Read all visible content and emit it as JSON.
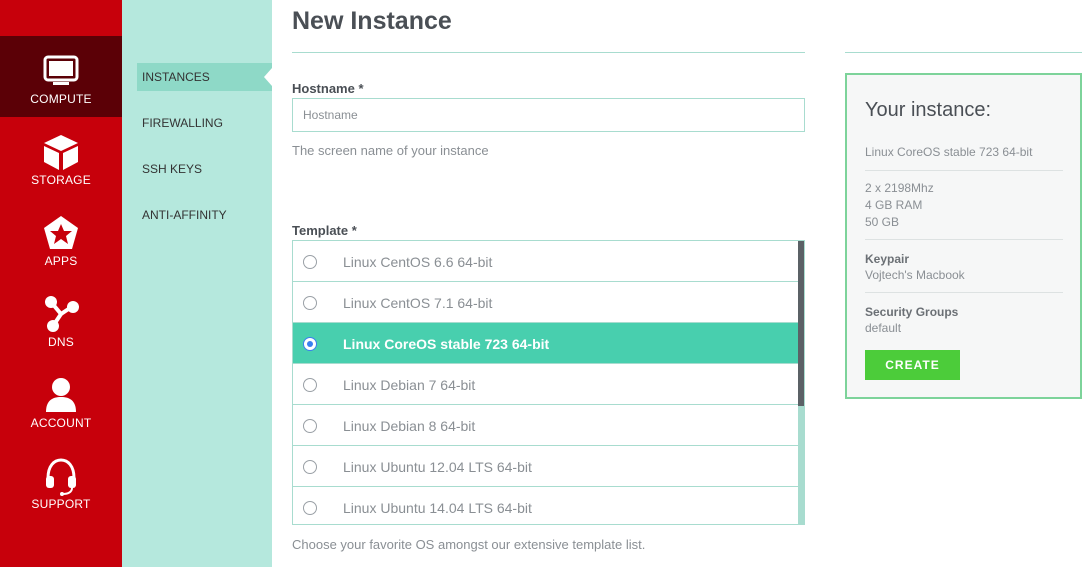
{
  "nav": {
    "items": [
      {
        "label": "COMPUTE",
        "icon": "monitor-icon",
        "active": true
      },
      {
        "label": "STORAGE",
        "icon": "cube-icon"
      },
      {
        "label": "APPS",
        "icon": "pentagon-star-icon"
      },
      {
        "label": "DNS",
        "icon": "share-nodes-icon"
      },
      {
        "label": "ACCOUNT",
        "icon": "user-icon"
      },
      {
        "label": "SUPPORT",
        "icon": "headset-icon"
      }
    ]
  },
  "subnav": {
    "items": [
      {
        "label": "INSTANCES",
        "active": true
      },
      {
        "label": "FIREWALLING"
      },
      {
        "label": "SSH KEYS"
      },
      {
        "label": "ANTI-AFFINITY"
      }
    ]
  },
  "main": {
    "title": "New Instance",
    "hostname": {
      "label": "Hostname *",
      "placeholder": "Hostname",
      "value": "",
      "help": "The screen name of your instance"
    },
    "template": {
      "label": "Template *",
      "options": [
        "Linux CentOS 6.6 64-bit",
        "Linux CentOS 7.1 64-bit",
        "Linux CoreOS stable 723 64-bit",
        "Linux Debian 7 64-bit",
        "Linux Debian 8 64-bit",
        "Linux Ubuntu 12.04 LTS 64-bit",
        "Linux Ubuntu 14.04 LTS 64-bit"
      ],
      "selected": "Linux CoreOS stable 723 64-bit",
      "help": "Choose your favorite OS amongst our extensive template list."
    }
  },
  "summary": {
    "title": "Your instance:",
    "template": "Linux CoreOS stable 723 64-bit",
    "cpu": "2 x 2198Mhz",
    "ram": "4 GB RAM",
    "disk": "50 GB",
    "keypair_label": "Keypair",
    "keypair_value": "Vojtech's Macbook",
    "security_label": "Security Groups",
    "security_value": "default",
    "create_label": "CREATE"
  },
  "colors": {
    "nav_bg": "#c7000b",
    "nav_active": "#5b0006",
    "subnav_bg": "#b5e8dd",
    "selected_row": "#48cfae",
    "create_button": "#4ccc3a"
  }
}
